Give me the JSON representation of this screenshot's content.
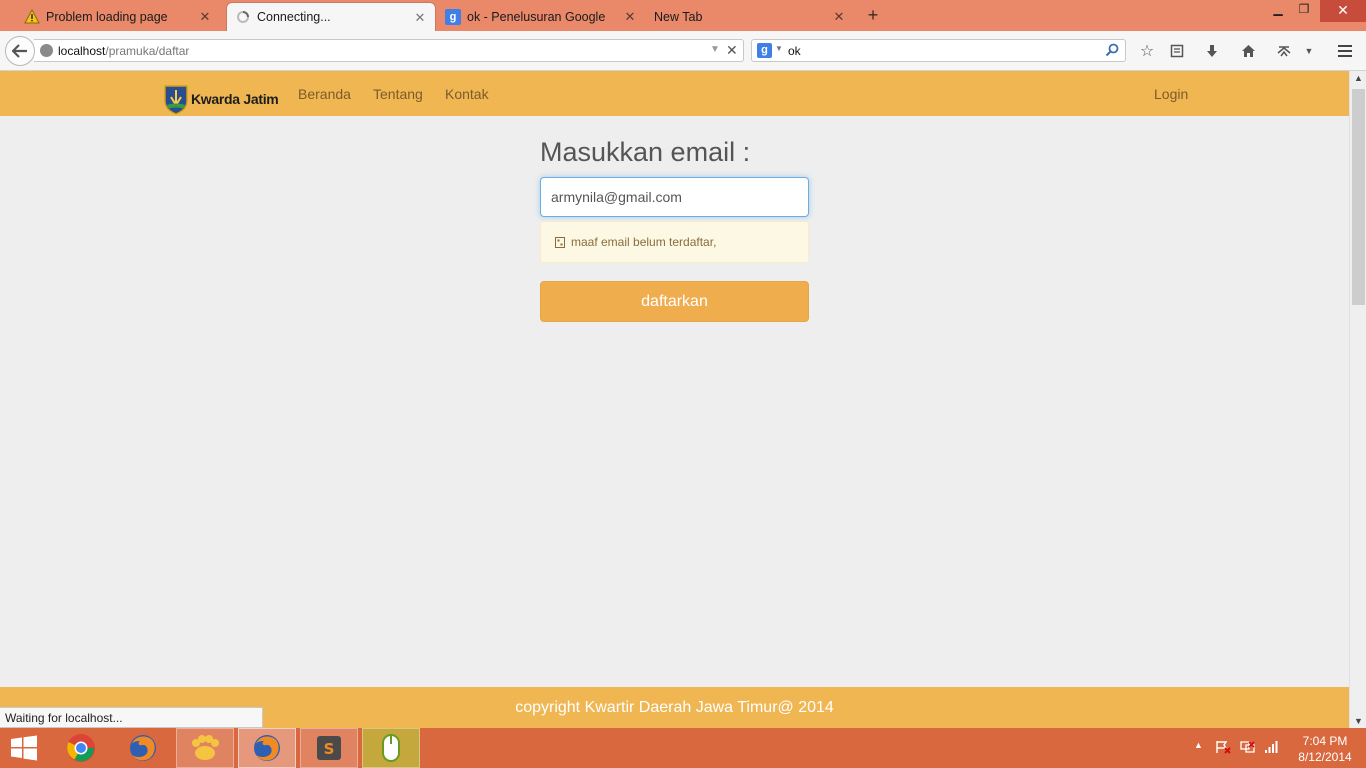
{
  "browser": {
    "tabs": [
      {
        "label": "Problem loading page",
        "icon": "warning-icon"
      },
      {
        "label": "Connecting...",
        "icon": "loading-spinner-icon"
      },
      {
        "label": "ok - Penelusuran Google",
        "icon": "google-icon"
      },
      {
        "label": "New Tab",
        "icon": ""
      }
    ],
    "url": {
      "host": "localhost",
      "path": "/pramuka/daftar"
    },
    "search": {
      "engine_icon": "google-icon",
      "query": "ok"
    },
    "toolbar_icons": [
      "star-icon",
      "reading-list-icon",
      "download-icon",
      "home-icon",
      "addon-icon",
      "menu-icon"
    ],
    "status": "Waiting for localhost..."
  },
  "site": {
    "brand": "Kwarda Jatim",
    "nav": {
      "home": "Beranda",
      "about": "Tentang",
      "contact": "Kontak",
      "login": "Login"
    },
    "form": {
      "title": "Masukkan email :",
      "email_value": "armynila@gmail.com",
      "alert": "maaf email belum terdaftar,",
      "submit": "daftarkan"
    },
    "footer": "copyright Kwartir Daerah Jawa Timur@ 2014"
  },
  "taskbar": {
    "apps": [
      "chrome-icon",
      "firefox-icon",
      "paw-app-icon",
      "firefox-icon",
      "sublime-text-icon",
      "mouse-app-icon"
    ],
    "clock": {
      "time": "7:04 PM",
      "date": "8/12/2014"
    }
  },
  "colors": {
    "header": "#f0b652",
    "button": "#f0ad4e",
    "alert_bg": "#fcf8e3",
    "alert_text": "#8a6d3b",
    "tabbar": "#e9896a",
    "taskbar": "#d9683f"
  }
}
